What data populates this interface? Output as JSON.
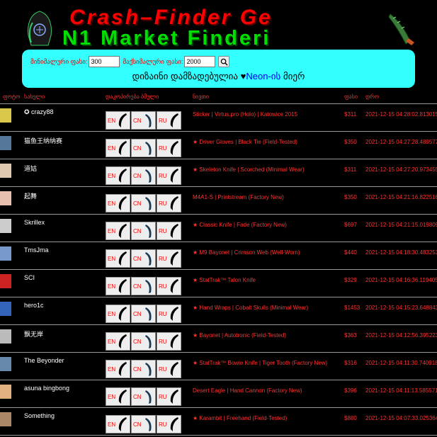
{
  "header": {
    "title_line1": "Crash–Finder Ge",
    "title_line2": "N1 Market Finderi"
  },
  "filter": {
    "min_label": "მინიმალური ფასი:",
    "min_value": "300",
    "max_label": "მაქსიმალური ფასი:",
    "max_value": "2000",
    "search_icon": "magnifier-icon",
    "credit_prefix": "დიზაინი დამზადებულია ",
    "credit_neon": "Neon-ის",
    "credit_suffix": " მიერ"
  },
  "table": {
    "headers": {
      "avatar": "ფოტო",
      "name": "სახელი",
      "links": "დაკოპირება ბმული",
      "item": "ნივთი",
      "price": "ფასი",
      "date": "დრო"
    },
    "lang_buttons": [
      "EN",
      "CN",
      "RU"
    ],
    "rows": [
      {
        "name": "✪ crazy88",
        "item": "Sticker | Virtus.pro (Holo) | Katowice 2015",
        "price": "$311",
        "date": "2021-12-15 04:28:02.813015",
        "avatar_color": "#d9c74a"
      },
      {
        "name": "猫鱼王纳纳赛",
        "item": "★ Driver Gloves | Black Tie (Field-Tested)",
        "price": "$350",
        "date": "2021-12-15 04:27:28.489577",
        "avatar_color": "#557799"
      },
      {
        "name": "道姑",
        "item": "★ Skeleton Knife | Scorched (Minimal Wear)",
        "price": "$311",
        "date": "2021-12-15 04:27:20.973455",
        "avatar_color": "#ddc8b0"
      },
      {
        "name": "起舞",
        "item": "M4A1-S | Printstream (Factory New)",
        "price": "$350",
        "date": "2021-12-15 04:21:16.822516",
        "avatar_color": "#e8c0b0"
      },
      {
        "name": "Skrillex",
        "item": "★ Classic Knife | Fade (Factory New)",
        "price": "$697",
        "date": "2021-12-15 04:21:15.019809",
        "avatar_color": "#cccccc"
      },
      {
        "name": "TmsJma",
        "item": "★ M9 Bayonet | Crimson Web (Well-Worn)",
        "price": "$440",
        "date": "2021-12-15 04:18:30.483253",
        "avatar_color": "#7799cc"
      },
      {
        "name": "SCI",
        "item": "★ StatTrak™ Talon Knife",
        "price": "$329",
        "date": "2021-12-15 04:16:36.119405",
        "avatar_color": "#cc2222"
      },
      {
        "name": "hero1c",
        "item": "★ Hand Wraps | Cobalt Skulls (Minimal Wear)",
        "price": "$1453",
        "date": "2021-12-15 04:15:23.648843",
        "avatar_color": "#3366bb"
      },
      {
        "name": "飘无岸",
        "item": "★ Bayonet | Autotronic (Field-Tested)",
        "price": "$363",
        "date": "2021-12-15 04:12:56.395223",
        "avatar_color": "#bbbbbb"
      },
      {
        "name": "The Beyonder",
        "item": "★ StatTrak™ Bowie Knife | Tiger Tooth (Factory New)",
        "price": "$316",
        "date": "2021-12-15 04:11:30.740918",
        "avatar_color": "#6688aa"
      },
      {
        "name": "asuna bingbong",
        "item": "Desert Eagle | Hand Cannon (Factory New)",
        "price": "$396",
        "date": "2021-12-15 04:11:13.585571",
        "avatar_color": "#e0b080"
      },
      {
        "name": "Something",
        "item": "★ Karambit | Freehand (Field-Tested)",
        "price": "$880",
        "date": "2021-12-15 04:07:33.025364",
        "avatar_color": "#aa8866"
      }
    ]
  },
  "colors": {
    "background": "#000000",
    "title_red": "#ff0000",
    "title_green": "#00e000",
    "filter_bg": "#33ffff",
    "table_text": "#ff3333"
  }
}
